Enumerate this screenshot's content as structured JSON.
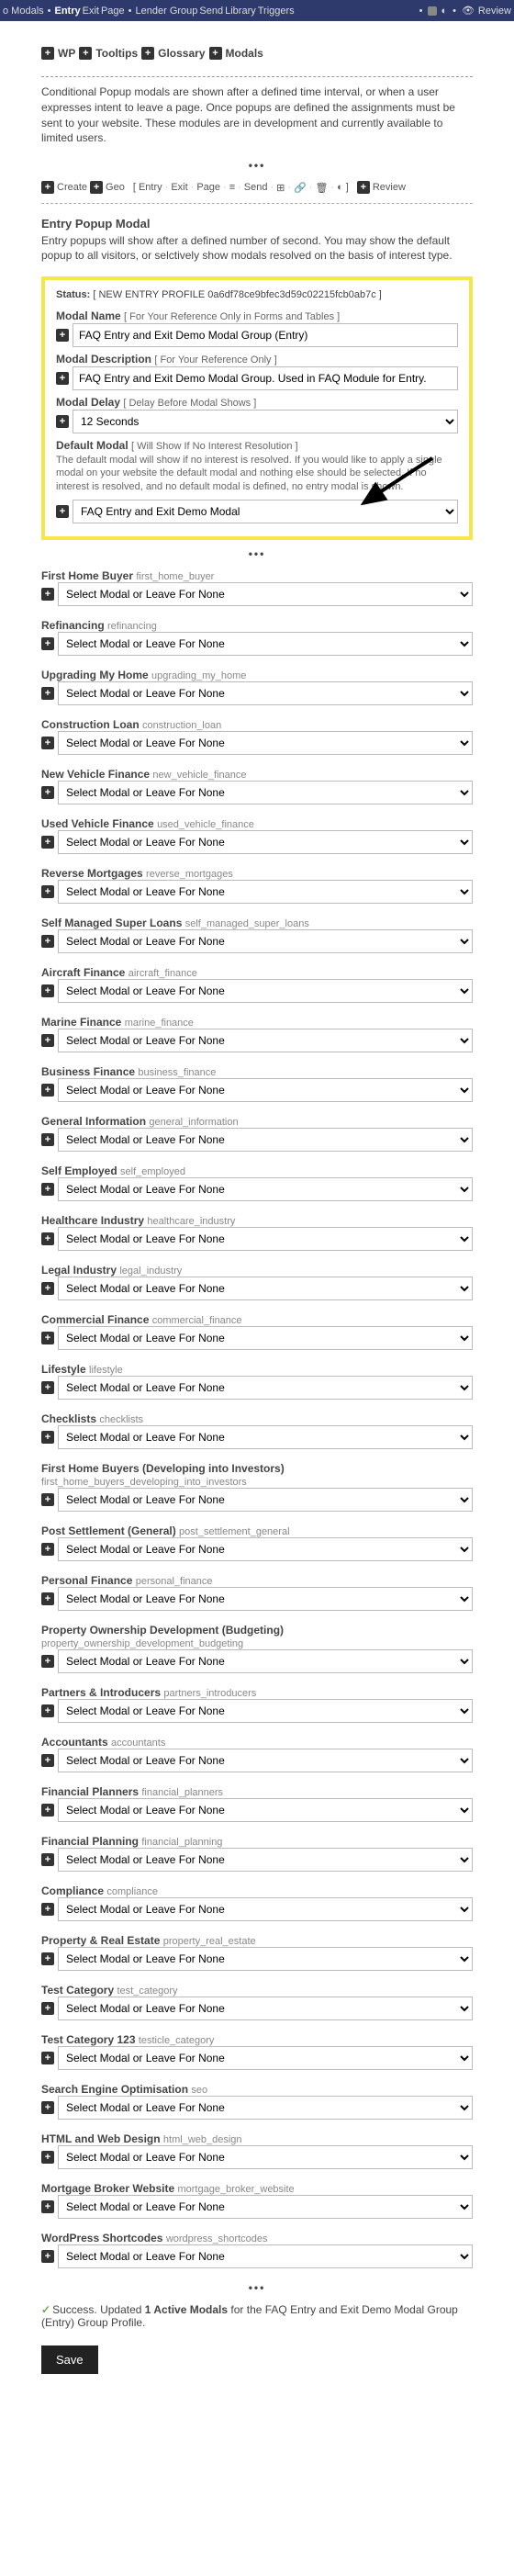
{
  "topnav": {
    "before": "o Modals",
    "entry": "Entry",
    "exit": "Exit",
    "page": "Page",
    "lender": "Lender Group",
    "send": "Send",
    "library": "Library",
    "triggers": "Triggers",
    "review": "Review"
  },
  "rowicons": {
    "wp": "WP",
    "tooltips": "Tooltips",
    "glossary": "Glossary",
    "modals": "Modals"
  },
  "intro": "Conditional Popup modals are shown after a defined time interval, or when a user expresses intent to leave a page. Once popups are defined the assignments must be sent to your website. These modules are in development and currently available to limited users.",
  "toolbar": {
    "create": "Create",
    "geo": "Geo",
    "bracket_l": "[",
    "entry": "Entry",
    "exit": "Exit",
    "page": "Page",
    "send": "Send",
    "bracket_r": "]",
    "review": "Review"
  },
  "entry_modal": {
    "title": "Entry Popup Modal",
    "desc": "Entry popups will show after a defined number of second. You may show the default popup to all visitors, or selctively show modals resolved on the basis of interest type."
  },
  "yellow": {
    "status_label": "Status:",
    "status_value": "[ NEW ENTRY PROFILE 0a6df78ce9bfec3d59c02215fcb0ab7c ]",
    "modal_name_lab": "Modal Name",
    "modal_name_note": "[ For Your Reference Only in Forms and Tables ]",
    "modal_name_val": "FAQ Entry and Exit Demo Modal Group (Entry)",
    "modal_desc_lab": "Modal Description",
    "modal_desc_note": "[ For Your Reference Only ]",
    "modal_desc_val": "FAQ Entry and Exit Demo Modal Group. Used in FAQ Module for Entry.",
    "delay_lab": "Modal Delay",
    "delay_note": "[ Delay Before Modal Shows ]",
    "delay_val": "12 Seconds",
    "default_lab": "Default Modal",
    "default_note": "[ Will Show If No Interest Resolution ]",
    "default_help": "The default modal will show if no interest is resolved. If you would like to apply a single modal on your website the default modal and nothing else should be selected. If no interest is resolved, and no default modal is defined, no entry modal is shown.",
    "default_val": "FAQ Entry and Exit Demo Modal"
  },
  "placeholder": "Select Modal or Leave For None",
  "interests": [
    {
      "title": "First Home Buyer",
      "slug": "first_home_buyer"
    },
    {
      "title": "Refinancing",
      "slug": "refinancing"
    },
    {
      "title": "Upgrading My Home",
      "slug": "upgrading_my_home"
    },
    {
      "title": "Construction Loan",
      "slug": "construction_loan"
    },
    {
      "title": "New Vehicle Finance",
      "slug": "new_vehicle_finance"
    },
    {
      "title": "Used Vehicle Finance",
      "slug": "used_vehicle_finance"
    },
    {
      "title": "Reverse Mortgages",
      "slug": "reverse_mortgages"
    },
    {
      "title": "Self Managed Super Loans",
      "slug": "self_managed_super_loans"
    },
    {
      "title": "Aircraft Finance",
      "slug": "aircraft_finance"
    },
    {
      "title": "Marine Finance",
      "slug": "marine_finance"
    },
    {
      "title": "Business Finance",
      "slug": "business_finance"
    },
    {
      "title": "General Information",
      "slug": "general_information"
    },
    {
      "title": "Self Employed",
      "slug": "self_employed"
    },
    {
      "title": "Healthcare Industry",
      "slug": "healthcare_industry"
    },
    {
      "title": "Legal Industry",
      "slug": "legal_industry"
    },
    {
      "title": "Commercial Finance",
      "slug": "commercial_finance"
    },
    {
      "title": "Lifestyle",
      "slug": "lifestyle"
    },
    {
      "title": "Checklists",
      "slug": "checklists"
    },
    {
      "title": "First Home Buyers (Developing into Investors)",
      "slug": "first_home_buyers_developing_into_investors"
    },
    {
      "title": "Post Settlement (General)",
      "slug": "post_settlement_general"
    },
    {
      "title": "Personal Finance",
      "slug": "personal_finance"
    },
    {
      "title": "Property Ownership Development (Budgeting)",
      "slug": "property_ownership_development_budgeting"
    },
    {
      "title": "Partners & Introducers",
      "slug": "partners_introducers"
    },
    {
      "title": "Accountants",
      "slug": "accountants"
    },
    {
      "title": "Financial Planners",
      "slug": "financial_planners"
    },
    {
      "title": "Financial Planning",
      "slug": "financial_planning"
    },
    {
      "title": "Compliance",
      "slug": "compliance"
    },
    {
      "title": "Property & Real Estate",
      "slug": "property_real_estate"
    },
    {
      "title": "Test Category",
      "slug": "test_category"
    },
    {
      "title": "Test Category 123",
      "slug": "testicle_category"
    },
    {
      "title": "Search Engine Optimisation",
      "slug": "seo"
    },
    {
      "title": "HTML and Web Design",
      "slug": "html_web_design"
    },
    {
      "title": "Mortgage Broker Website",
      "slug": "mortgage_broker_website"
    },
    {
      "title": "WordPress Shortcodes",
      "slug": "wordpress_shortcodes"
    }
  ],
  "success": {
    "prefix": "Success. Updated ",
    "bold": "1 Active Modals",
    "suffix": " for the FAQ Entry and Exit Demo Modal Group (Entry) Group Profile."
  },
  "save": "Save"
}
